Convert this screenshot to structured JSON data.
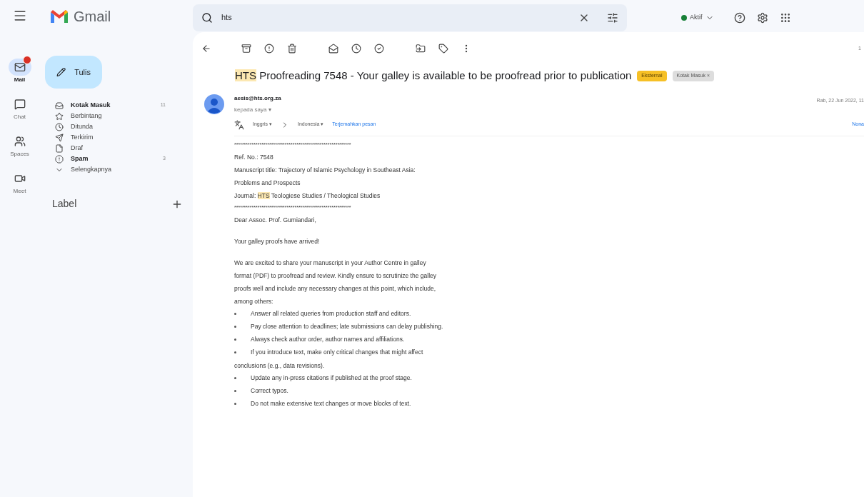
{
  "app": {
    "name": "Gmail"
  },
  "rail": [
    {
      "label": "Mail",
      "kind": "mail",
      "selected": true,
      "badge": true
    },
    {
      "label": "Chat",
      "kind": "chat",
      "selected": false,
      "badge": false
    },
    {
      "label": "Spaces",
      "kind": "spaces",
      "selected": false,
      "badge": false
    },
    {
      "label": "Meet",
      "kind": "meet",
      "selected": false,
      "badge": false
    }
  ],
  "compose": {
    "label": "Tulis"
  },
  "folders": [
    {
      "label": "Kotak Masuk",
      "kind": "inbox",
      "unread": true,
      "count": "11"
    },
    {
      "label": "Berbintang",
      "kind": "star",
      "unread": false
    },
    {
      "label": "Ditunda",
      "kind": "clock",
      "unread": false
    },
    {
      "label": "Terkirim",
      "kind": "send",
      "unread": false
    },
    {
      "label": "Draf",
      "kind": "file",
      "unread": false
    },
    {
      "label": "Spam",
      "kind": "spam",
      "unread": true,
      "count": "3"
    },
    {
      "label": "Selengkapnya",
      "kind": "more",
      "unread": false
    }
  ],
  "labels": {
    "title": "Label"
  },
  "search": {
    "value": "hts"
  },
  "status": {
    "label": "Aktif",
    "color": "#188038"
  },
  "pagination": "1",
  "message": {
    "subject_highlight": "HTS",
    "subject": " Proofreading 7548 - Your galley is available to be proofread prior to publication",
    "tags": [
      {
        "label": "Eksternal",
        "kind": "external"
      },
      {
        "label": "Kotak Masuk ×",
        "kind": "folder"
      }
    ],
    "sender": "aesis@hts.org.za",
    "recipient": "kepada saya ▾",
    "date": "Rab, 22 Jun 2022, 11",
    "translate": {
      "from": "Inggris ▾",
      "to": "Indonesia ▾",
      "action": "Terjemahkan pesan",
      "off": "Nona"
    },
    "body": [
      {
        "kind": "rule",
        "text": "************************************************************"
      },
      {
        "kind": "line",
        "text": "Ref. No.: 7548"
      },
      {
        "kind": "line",
        "text": "Manuscript title: Trajectory of Islamic Psychology in Southeast Asia:"
      },
      {
        "kind": "line",
        "text": "Problems and Prospects"
      },
      {
        "kind": "line",
        "text": "Journal: ",
        "highlight": "HTS",
        "after": " Teologiese Studies / Theological Studies"
      },
      {
        "kind": "rule",
        "text": "************************************************************"
      },
      {
        "kind": "line",
        "text": "Dear Assoc. Prof. Gumiandari,"
      },
      {
        "kind": "blank"
      },
      {
        "kind": "line",
        "text": "Your galley proofs have arrived!"
      },
      {
        "kind": "blank"
      },
      {
        "kind": "line",
        "text": "We are excited to share your manuscript in your Author Centre in galley"
      },
      {
        "kind": "line",
        "text": "format (PDF) to proofread and review. Kindly ensure to scrutinize the galley"
      },
      {
        "kind": "line",
        "text": "proofs well and include any necessary changes at this point, which include,"
      },
      {
        "kind": "line",
        "text": "among others:"
      },
      {
        "kind": "bullet",
        "text": "Answer all related queries from production staff and editors."
      },
      {
        "kind": "bullet",
        "text": "Pay close attention to deadlines; late submissions can delay publishing."
      },
      {
        "kind": "bullet",
        "text": "Always check author order, author names and affiliations."
      },
      {
        "kind": "bullet",
        "text": "If you introduce text, make only critical changes that might affect"
      },
      {
        "kind": "line",
        "text": "conclusions (e.g., data revisions)."
      },
      {
        "kind": "bullet",
        "text": "Update any in-press citations if published at the proof stage."
      },
      {
        "kind": "bullet",
        "text": "Correct typos."
      },
      {
        "kind": "bullet",
        "text": "Do not make extensive text changes or move blocks of text."
      }
    ]
  }
}
